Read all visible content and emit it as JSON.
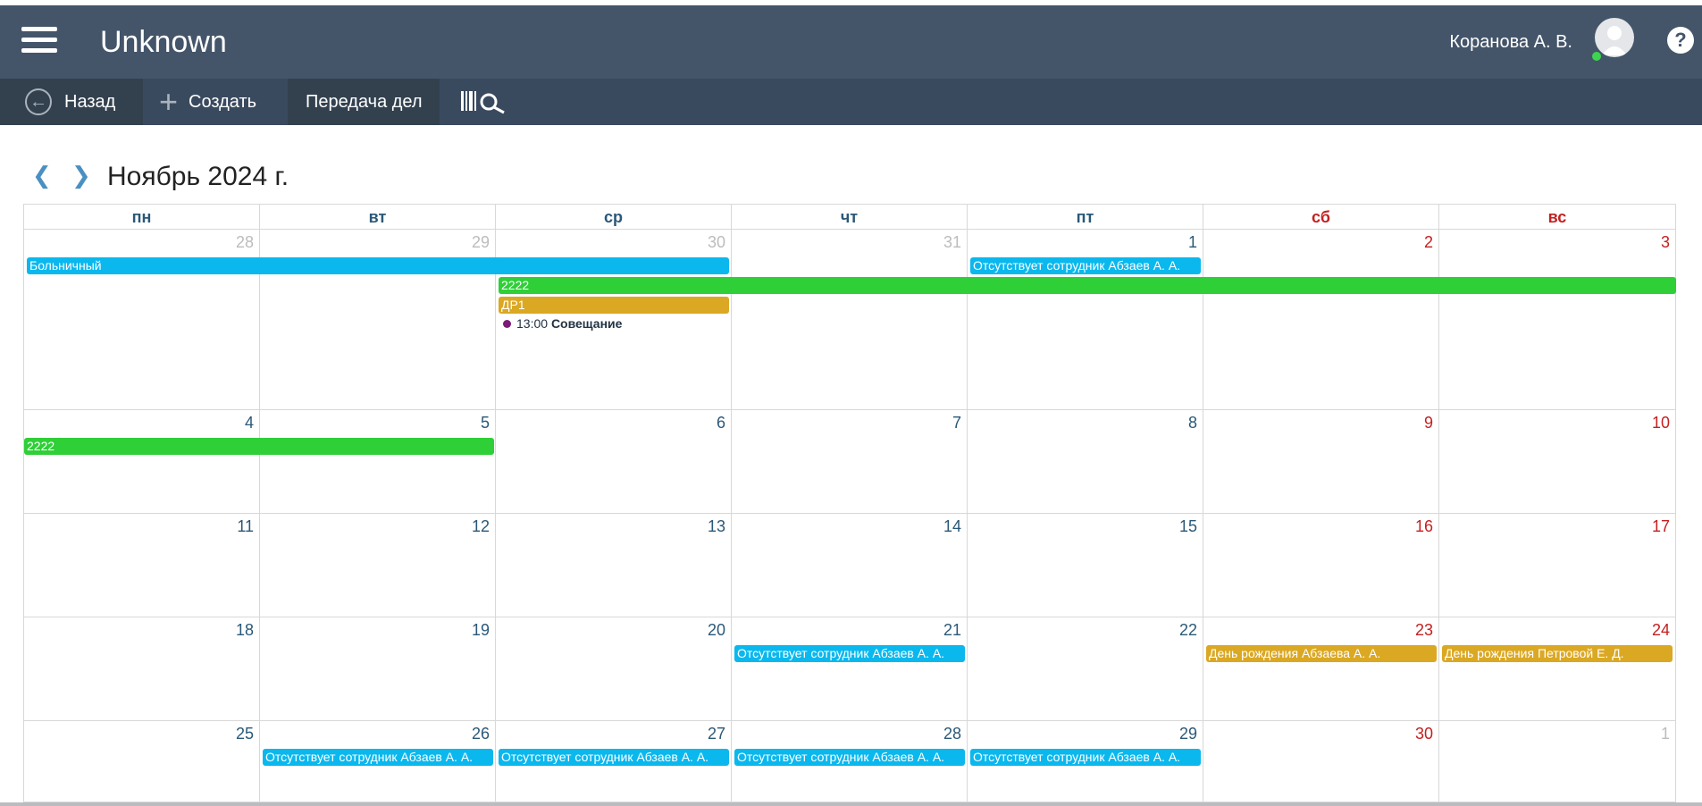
{
  "header": {
    "app_title": "Unknown",
    "user_name": "Коранова А. В.",
    "help_label": "?",
    "status_color": "#3bd64b"
  },
  "toolbar": {
    "back_label": "Назад",
    "create_label": "Создать",
    "transfer_label": "Передача дел",
    "barcode_icon": "barcode-search-icon"
  },
  "calendar": {
    "month_title": "Ноябрь 2024 г.",
    "prev_label": "❮",
    "next_label": "❯",
    "weekdays": [
      "пн",
      "вт",
      "ср",
      "чт",
      "пт",
      "сб",
      "вс"
    ],
    "weeks": [
      [
        "28",
        "29",
        "30",
        "31",
        "1",
        "2",
        "3"
      ],
      [
        "4",
        "5",
        "6",
        "7",
        "8",
        "9",
        "10"
      ],
      [
        "11",
        "12",
        "13",
        "14",
        "15",
        "16",
        "17"
      ],
      [
        "18",
        "19",
        "20",
        "21",
        "22",
        "23",
        "24"
      ],
      [
        "25",
        "26",
        "27",
        "28",
        "29",
        "30",
        "1"
      ]
    ],
    "events": {
      "sick": "Больничный",
      "absent": "Отсутствует сотрудник Абзаев А. А.",
      "e2222": "2222",
      "dr1": "ДР1",
      "meeting_time": "13:00",
      "meeting_title": "Совещание",
      "bday_abzaev": "День рождения Абзаева А. А.",
      "bday_petrova": "День рождения Петровой Е. Д."
    },
    "colors": {
      "blue": "#0ab8ee",
      "green": "#2fcf37",
      "gold": "#dba823",
      "weekend": "#c42020",
      "weekday": "#2a5878"
    }
  }
}
